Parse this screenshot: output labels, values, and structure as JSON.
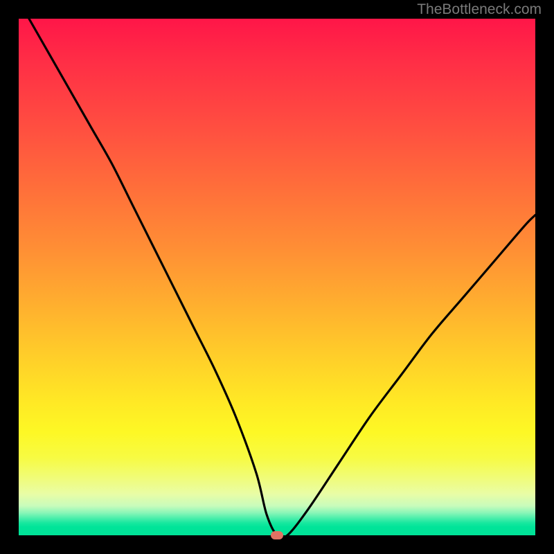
{
  "watermark": "TheBottleneck.com",
  "colors": {
    "frame": "#000000",
    "curve": "#000000",
    "dot": "#e07263",
    "gradient_top": "#ff1648",
    "gradient_bottom": "#00e297"
  },
  "chart_data": {
    "type": "line",
    "title": "",
    "xlabel": "",
    "ylabel": "",
    "xlim": [
      0,
      100
    ],
    "ylim": [
      0,
      100
    ],
    "annotations": {
      "minimum_marker_x": 50,
      "minimum_marker_y": 0
    },
    "series": [
      {
        "name": "bottleneck-curve",
        "x": [
          2,
          6,
          10,
          14,
          18,
          22,
          26,
          30,
          34,
          38,
          42,
          46,
          48,
          50,
          52,
          56,
          62,
          68,
          74,
          80,
          86,
          92,
          98,
          100
        ],
        "y": [
          100,
          93,
          86,
          79,
          72,
          64,
          56,
          48,
          40,
          32,
          23,
          12,
          4,
          0,
          0,
          5,
          14,
          23,
          31,
          39,
          46,
          53,
          60,
          62
        ]
      }
    ]
  }
}
